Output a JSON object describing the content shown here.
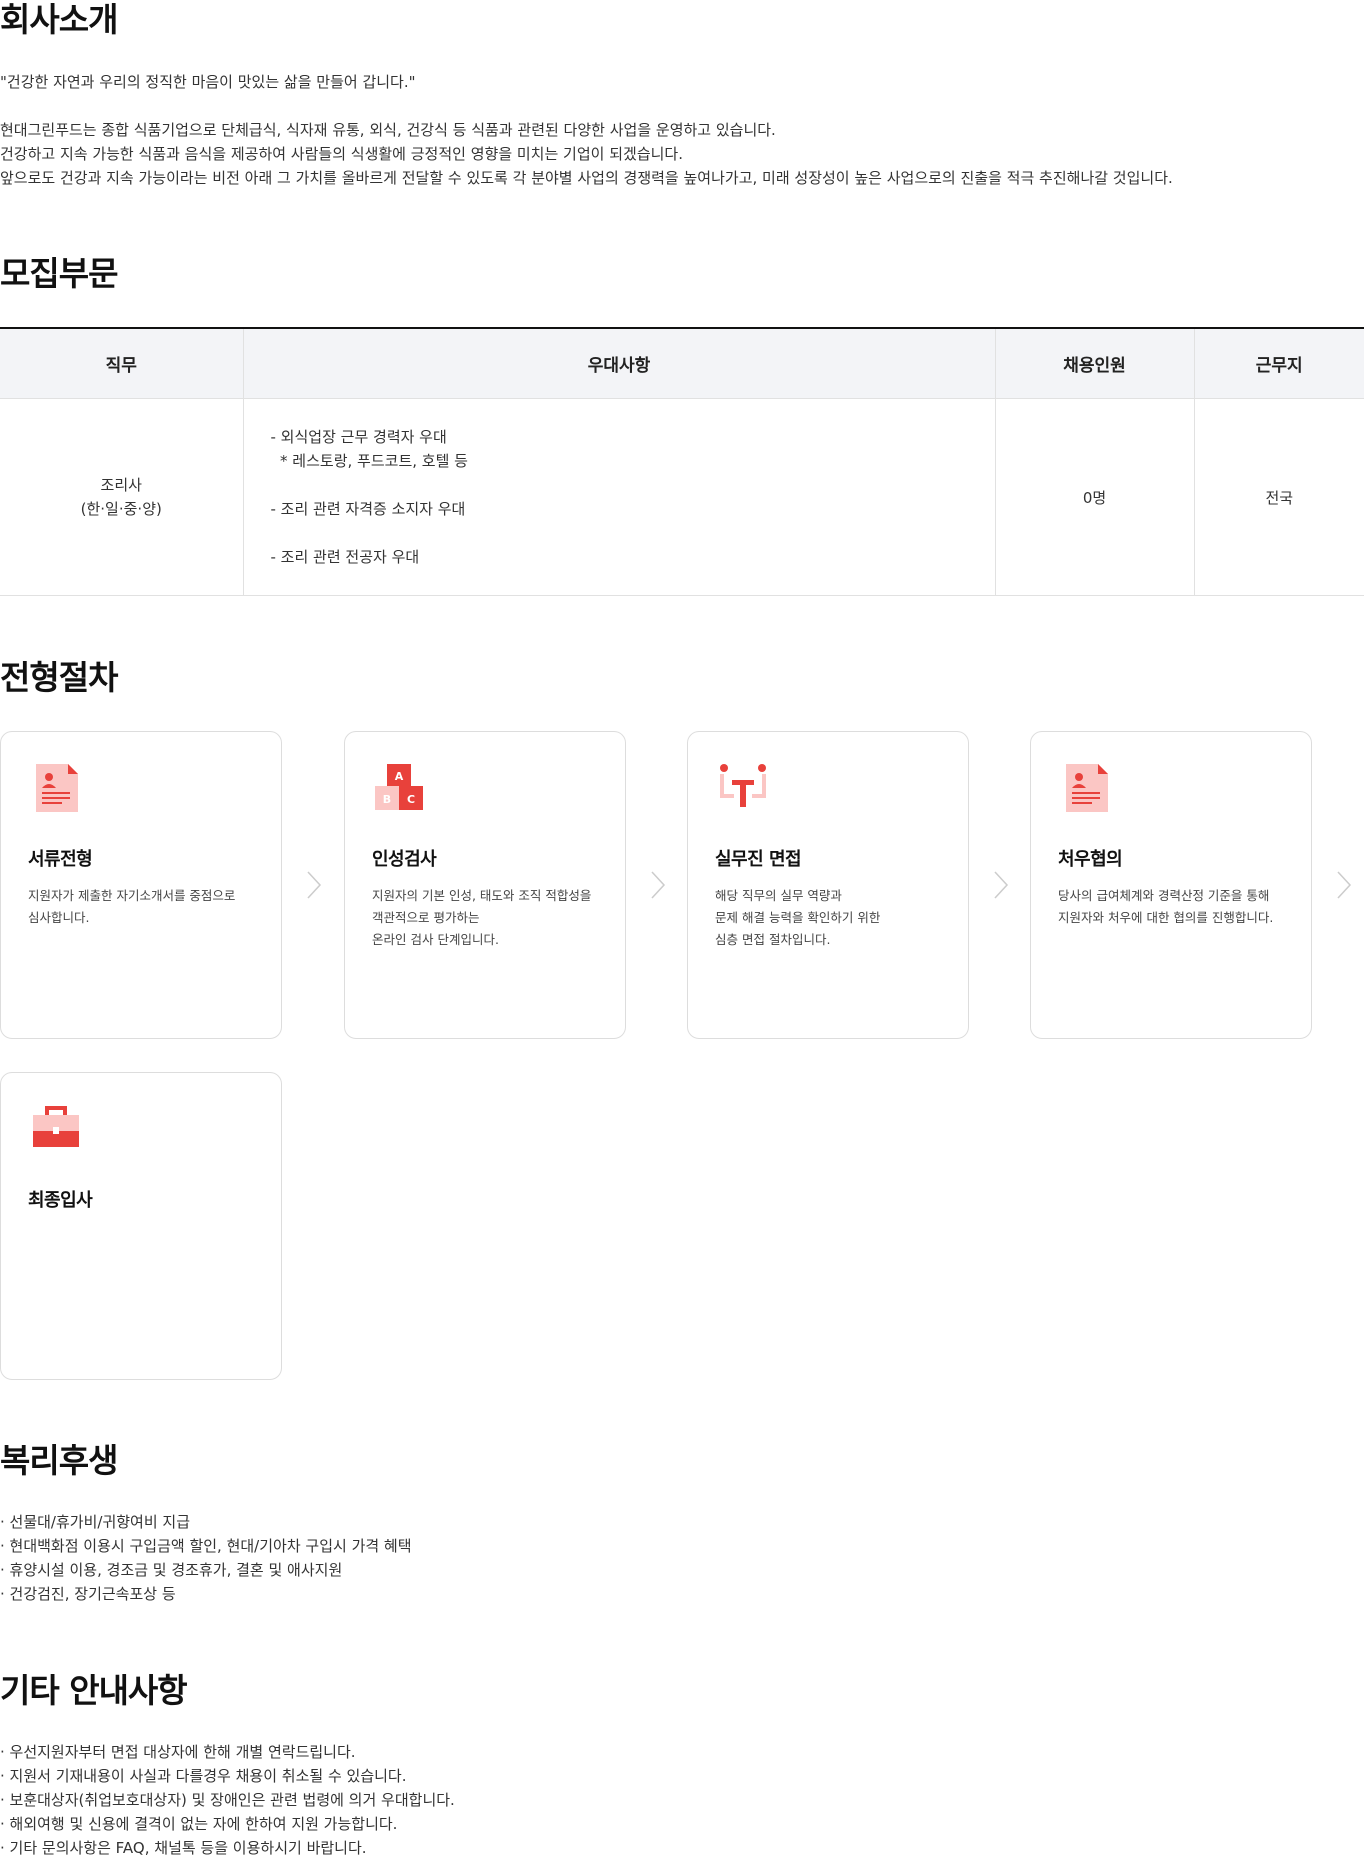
{
  "intro": {
    "title": "회사소개",
    "quote": "\"건강한 자연과 우리의 정직한 마음이 맛있는 삶을 만들어 갑니다.\"",
    "lines": [
      "현대그린푸드는 종합 식품기업으로 단체급식, 식자재 유통, 외식, 건강식 등 식품과 관련된 다양한 사업을 운영하고 있습니다.",
      "건강하고 지속 가능한 식품과 음식을 제공하여 사람들의 식생활에 긍정적인 영향을 미치는 기업이 되겠습니다.",
      "앞으로도 건강과 지속 가능이라는 비전 아래 그 가치를 올바르게 전달할 수 있도록 각 분야별 사업의 경쟁력을 높여나가고, 미래 성장성이 높은 사업으로의 진출을 적극 추진해나갈 것입니다."
    ]
  },
  "recruit": {
    "title": "모집부문",
    "headers": [
      "직무",
      "우대사항",
      "채용인원",
      "근무지"
    ],
    "row": {
      "job_lines": [
        "조리사",
        "(한·일·중·양)"
      ],
      "pref_lines": [
        "- 외식업장 근무 경력자 우대",
        "  * 레스토랑, 푸드코트, 호텔 등",
        "",
        "- 조리 관련 자격증 소지자 우대",
        "",
        "- 조리 관련 전공자 우대"
      ],
      "count": "0명",
      "location": "전국"
    }
  },
  "process": {
    "title": "전형절차",
    "steps": [
      {
        "icon": "document-icon",
        "title": "서류전형",
        "desc": [
          "지원자가 제출한 자기소개서를 중점으로",
          "심사합니다."
        ]
      },
      {
        "icon": "abc-blocks-icon",
        "title": "인성검사",
        "desc": [
          "지원자의 기본 인성, 태도와 조직 적합성을",
          "객관적으로 평가하는",
          "온라인 검사 단계입니다."
        ]
      },
      {
        "icon": "interview-icon",
        "title": "실무진 면접",
        "desc": [
          "해당 직무의 실무 역량과",
          "문제 해결 능력을 확인하기 위한",
          "심층 면접 절차입니다."
        ]
      },
      {
        "icon": "document-icon",
        "title": "처우협의",
        "desc": [
          "당사의 급여체계와 경력산정 기준을 통해",
          "지원자와 처우에 대한 협의를 진행합니다."
        ]
      },
      {
        "icon": "briefcase-icon",
        "title": "최종입사",
        "desc": []
      }
    ]
  },
  "benefits": {
    "title": "복리후생",
    "items": [
      "· 선물대/휴가비/귀향여비 지급",
      "· 현대백화점 이용시 구입금액 할인, 현대/기아차 구입시 가격 혜택",
      "· 휴양시설 이용, 경조금 및 경조휴가, 결혼 및 애사지원",
      "· 건강검진, 장기근속포상 등"
    ]
  },
  "etc": {
    "title": "기타 안내사항",
    "items": [
      "· 우선지원자부터 면접 대상자에 한해 개별 연락드립니다.",
      "· 지원서 기재내용이 사실과 다를경우 채용이 취소될 수 있습니다.",
      "· 보훈대상자(취업보호대상자) 및 장애인은 관련 법령에 의거 우대합니다.",
      "· 해외여행 및 신용에 결격이 없는 자에 한하여 지원 가능합니다.",
      "· 기타 문의사항은 FAQ, 채널톡 등을 이용하시기 바랍니다."
    ]
  },
  "colors": {
    "accent": "#e8413b",
    "accent_light": "#fbc6c4",
    "table_header_bg": "#f3f4f7",
    "border": "#dddddd"
  }
}
